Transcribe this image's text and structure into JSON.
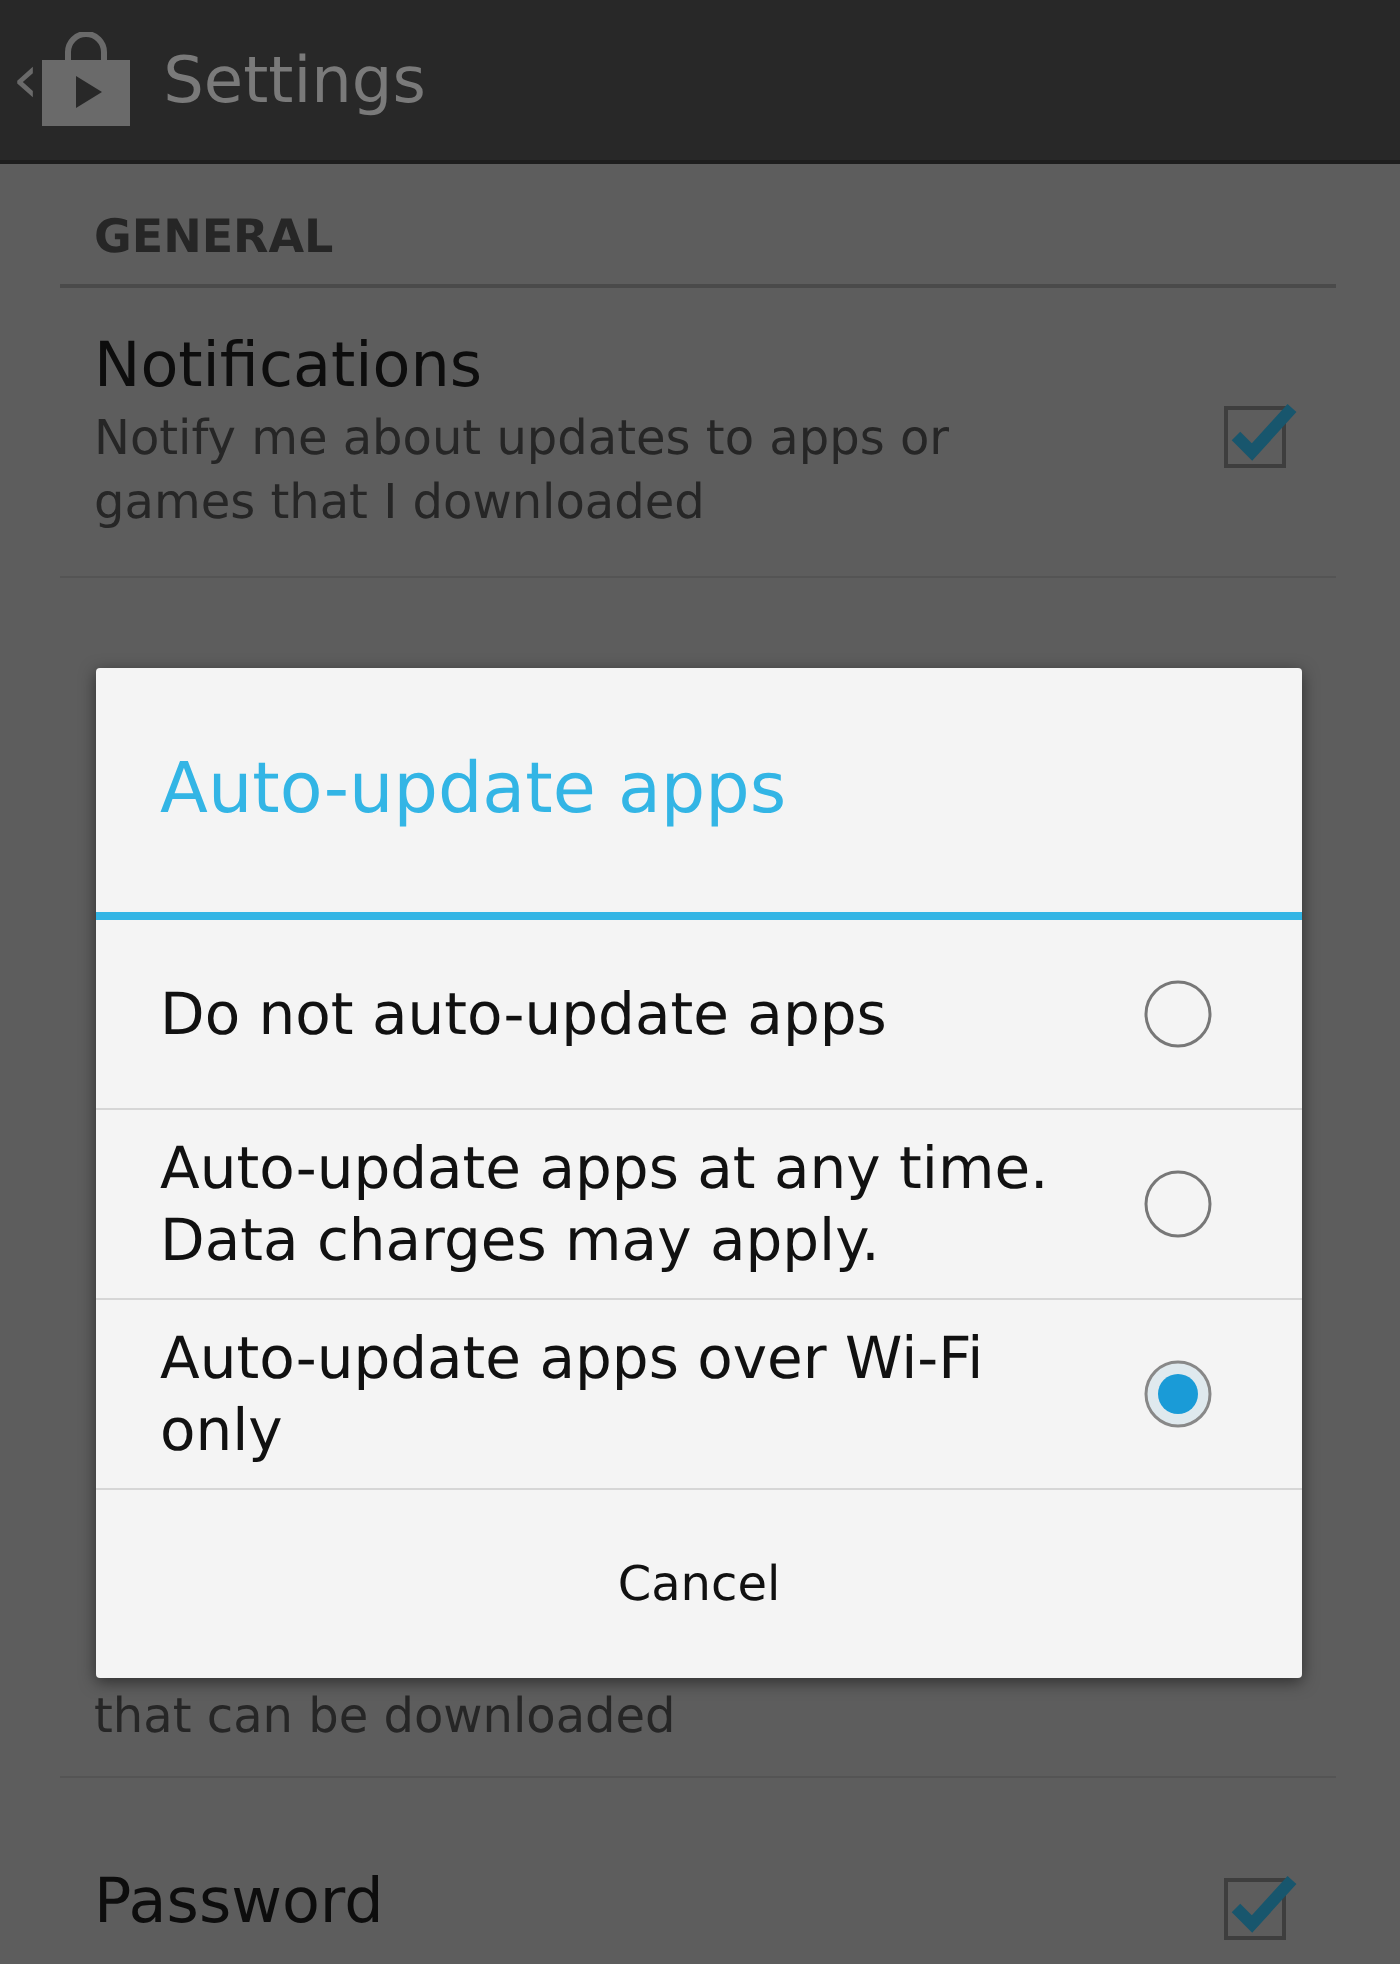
{
  "action_bar": {
    "back": "‹",
    "title": "Settings"
  },
  "section": "GENERAL",
  "settings": [
    {
      "kind": "toggle",
      "title": "Notifications",
      "summary": "Notify me about updates to apps or games that I downloaded",
      "checked": true
    },
    {
      "kind": "summary",
      "summary": "that can be downloaded"
    },
    {
      "kind": "toggle",
      "title": "Password",
      "checked": true
    }
  ],
  "dialog": {
    "title": "Auto-update apps",
    "options": [
      {
        "label": "Do not auto-update apps",
        "selected": false
      },
      {
        "label": "Auto-update apps at any time. Data charges may apply.",
        "selected": false
      },
      {
        "label": "Auto-update apps over Wi-Fi only",
        "selected": true
      }
    ],
    "button": "Cancel"
  }
}
